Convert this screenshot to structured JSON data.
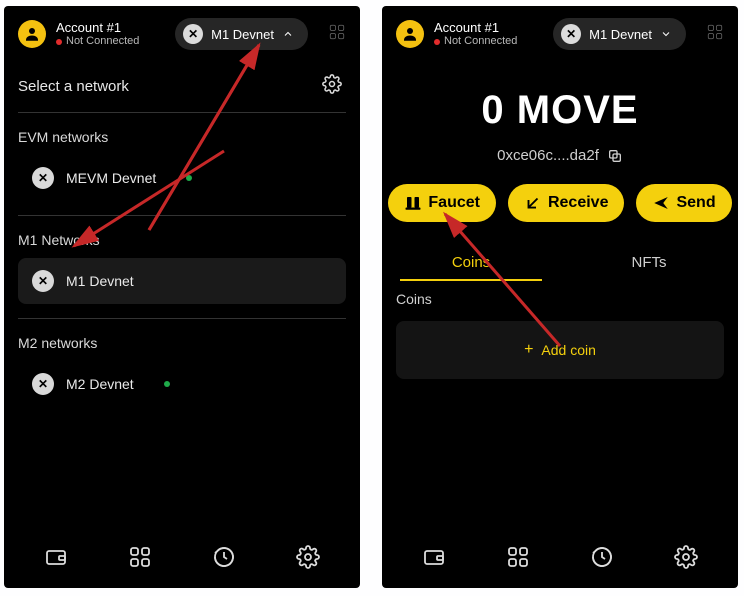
{
  "left": {
    "account": {
      "name": "Account #1",
      "status": "Not Connected"
    },
    "net_pill": "M1 Devnet",
    "select_title": "Select a network",
    "sections": {
      "evm": {
        "label": "EVM networks",
        "items": [
          {
            "name": "MEVM Devnet"
          }
        ]
      },
      "m1": {
        "label": "M1 Networks",
        "items": [
          {
            "name": "M1 Devnet"
          }
        ]
      },
      "m2": {
        "label": "M2 networks",
        "items": [
          {
            "name": "M2 Devnet"
          }
        ]
      }
    }
  },
  "right": {
    "account": {
      "name": "Account #1",
      "status": "Not Connected"
    },
    "net_pill": "M1 Devnet",
    "balance": "0 MOVE",
    "address": "0xce06c....da2f",
    "actions": {
      "faucet": "Faucet",
      "receive": "Receive",
      "send": "Send"
    },
    "tabs": {
      "coins": "Coins",
      "nfts": "NFTs"
    },
    "coins_header": "Coins",
    "add_coin": "Add coin"
  }
}
